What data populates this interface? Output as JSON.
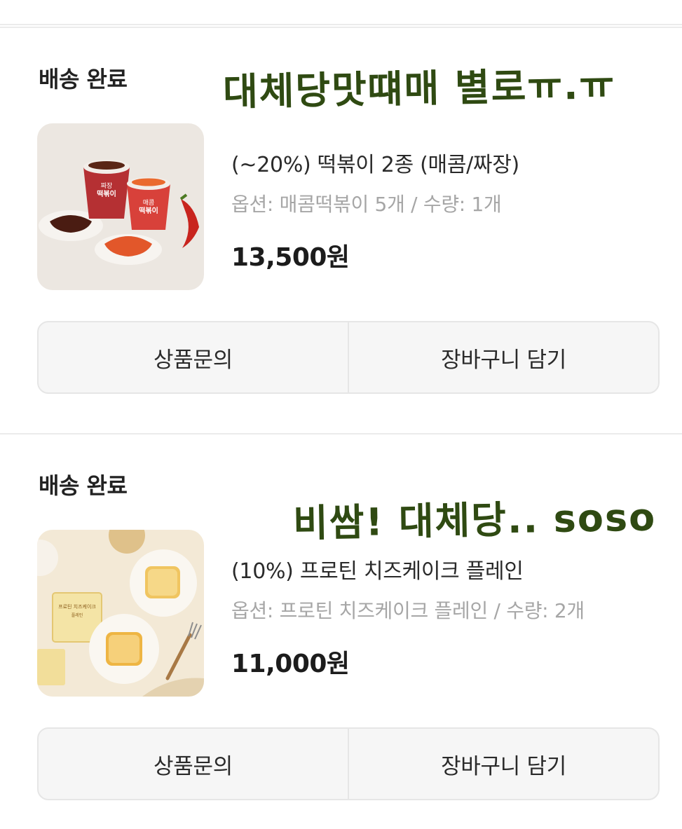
{
  "orders": [
    {
      "status": "배송 완료",
      "note": "대체당맛떄매 별로ㅠ.ㅠ",
      "product": {
        "name": "(~20%) 떡볶이 2종 (매콤/짜장)",
        "option": "옵션: 매콤떡볶이 5개 / 수량: 1개",
        "price": "13,500원",
        "image_icon": "tteokbokki-photo",
        "image_text": [
          "짜장",
          "떡볶이",
          "매콤",
          "떡볶이"
        ]
      },
      "buttons": {
        "inquiry": "상품문의",
        "cart": "장바구니 담기"
      }
    },
    {
      "status": "배송 완료",
      "note": "비쌈! 대체당.. soso",
      "product": {
        "name": "(10%) 프로틴 치즈케이크 플레인",
        "option": "옵션: 프로틴 치즈케이크 플레인 / 수량: 2개",
        "price": "11,000원",
        "image_icon": "cheesecake-photo",
        "image_text": [
          "프로틴 치즈케이크",
          "플레인"
        ]
      },
      "buttons": {
        "inquiry": "상품문의",
        "cart": "장바구니 담기"
      }
    }
  ],
  "colors": {
    "divider": "#ebebeb",
    "button_bg": "#f6f6f6",
    "option_text": "#a6a6a6",
    "handwriting": "#2f4a12"
  }
}
